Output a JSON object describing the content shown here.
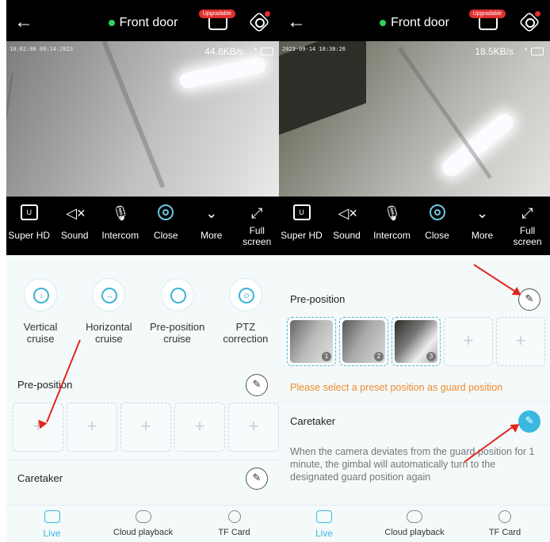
{
  "left": {
    "title": "Front door",
    "upgrade_badge": "Upgradable",
    "timestamp": "10:02:00 09:14:2023",
    "speed": "44.6KB/s",
    "controls": [
      {
        "label": "Super HD",
        "icon": "hd-icon"
      },
      {
        "label": "Sound",
        "icon": "speaker-mute-icon"
      },
      {
        "label": "Intercom",
        "icon": "microphone-icon"
      },
      {
        "label": "Close",
        "icon": "camera-icon"
      },
      {
        "label": "More",
        "icon": "chevron-down-icon"
      },
      {
        "label": "Full\nscreen",
        "icon": "fullscreen-icon"
      }
    ],
    "cruise": [
      {
        "label": "Vertical\ncruise",
        "glyph": "↕"
      },
      {
        "label": "Horizontal\ncruise",
        "glyph": "↔"
      },
      {
        "label": "Pre-position\ncruise",
        "glyph": "◌"
      },
      {
        "label": "PTZ\ncorrection",
        "glyph": "⊙"
      }
    ],
    "preposition_title": "Pre-position",
    "caretaker_title": "Caretaker"
  },
  "right": {
    "title": "Front door",
    "upgrade_badge": "Upgradable",
    "timestamp": "2023-09-14 10:38:26",
    "speed": "18.5KB/s",
    "controls": [
      {
        "label": "Super HD",
        "icon": "hd-icon"
      },
      {
        "label": "Sound",
        "icon": "speaker-mute-icon"
      },
      {
        "label": "Intercom",
        "icon": "microphone-icon"
      },
      {
        "label": "Close",
        "icon": "camera-icon"
      },
      {
        "label": "More",
        "icon": "chevron-down-icon"
      },
      {
        "label": "Full\nscreen",
        "icon": "fullscreen-icon"
      }
    ],
    "preposition_title": "Pre-position",
    "slots": [
      {
        "number": "1"
      },
      {
        "number": "2"
      },
      {
        "number": "3"
      }
    ],
    "guard_message": "Please select a preset position as guard position",
    "caretaker_title": "Caretaker",
    "caretaker_desc": "When the camera deviates from the guard position for 1 minute, the gimbal will automatically turn to the designated guard position again"
  },
  "tabs": [
    {
      "label": "Live",
      "icon": "live-icon"
    },
    {
      "label": "Cloud playback",
      "icon": "cloud-playback-icon"
    },
    {
      "label": "TF Card",
      "icon": "tf-card-icon"
    }
  ],
  "colors": {
    "accent": "#3ab9e0",
    "warning": "#f08a2c",
    "annotation_arrow": "#e2261d",
    "online_dot": "#2fcf5f"
  }
}
